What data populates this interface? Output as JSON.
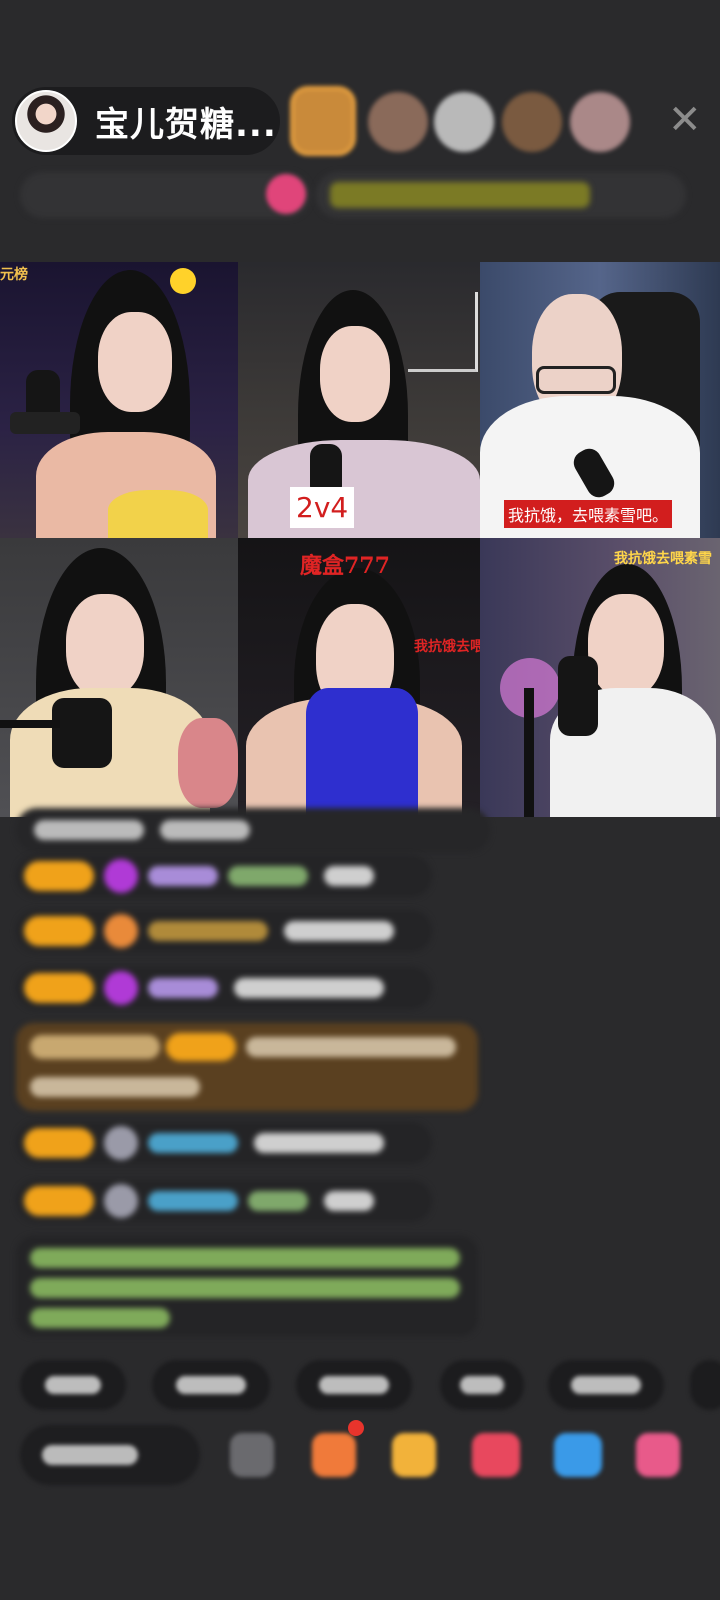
{
  "header": {
    "host_name": "宝儿贺糖..."
  },
  "grid": {
    "cells": [
      {
        "label": "元榜"
      },
      {
        "label": "2v4"
      },
      {
        "label": "我抗饿，去喂素雪吧。"
      },
      {
        "label": ""
      },
      {
        "label": "魔盒777",
        "sub_label": "我抗饿去喂"
      },
      {
        "label": "我抗饿去喂素雪"
      }
    ]
  },
  "icons": {
    "close": "close-icon"
  }
}
